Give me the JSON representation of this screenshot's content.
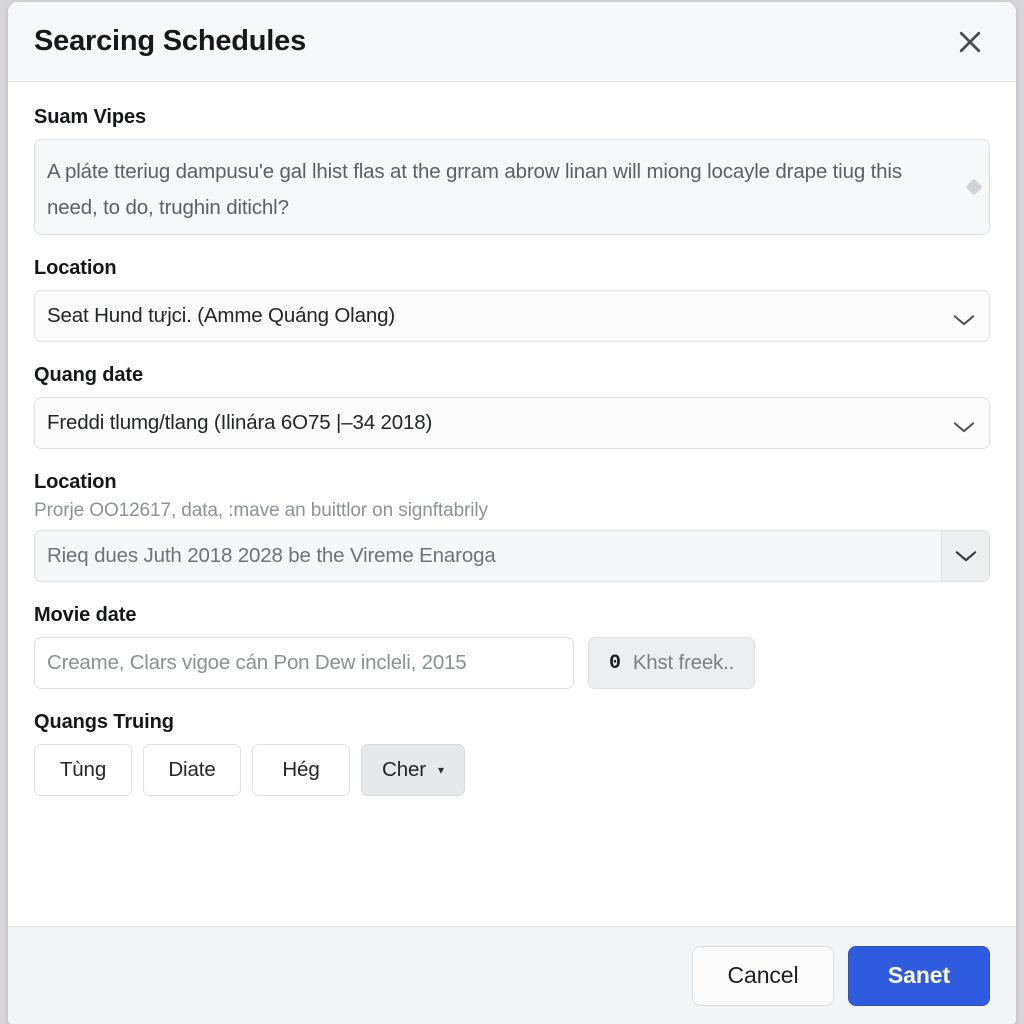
{
  "dialog": {
    "title": "Searcing Schedules",
    "close_icon": "close-icon"
  },
  "fields": {
    "summary": {
      "label": "Suam Vipes",
      "value": "A pláte tteriug dampusu'e gal lhist flas at the grram abrow linan will miong locayle drape tiug this need, to do, trughin ditichl?"
    },
    "location_one": {
      "label": "Location",
      "value": "Seat Hund tưjci. (Amme Quáng Olang)",
      "chevron_icon": "chevron-down-icon"
    },
    "quang_date": {
      "label": "Quang date",
      "value": "Freddi tlumg/tlang (Ilinára 6O75 |–34 2018)",
      "chevron_icon": "chevron-down-icon"
    },
    "location_two": {
      "label": "Location",
      "help": "Prorje OO12617, data, :mave an buittlor on signftabrily",
      "value": "Rieq dues Juth 2018 2028 be the Vireme Enaroga",
      "chevron_icon": "chevron-down-icon"
    },
    "movie_date": {
      "label": "Movie date",
      "placeholder": "Creame, Clars vigoe cán Pon Dew incleli, 2015",
      "value": "",
      "action_button": {
        "glyph": "0",
        "label": "Khst fɾeek.."
      }
    },
    "quangs_truing": {
      "label": "Quangs Truing",
      "options": [
        {
          "label": "Tùng",
          "active": false,
          "caret": false
        },
        {
          "label": "Diate",
          "active": false,
          "caret": false
        },
        {
          "label": "Hég",
          "active": false,
          "caret": false
        },
        {
          "label": "Cher",
          "active": true,
          "caret": true
        }
      ],
      "caret_glyph": "▾"
    }
  },
  "footer": {
    "cancel_label": "Cancel",
    "submit_label": "Sanet"
  },
  "colors": {
    "primary": "#2f5bde",
    "dialog_bg": "#ffffff",
    "header_bg": "#f7f8f9",
    "footer_bg": "#f4f5f6",
    "border": "#dfe1e3",
    "muted_text": "#8e9297"
  }
}
